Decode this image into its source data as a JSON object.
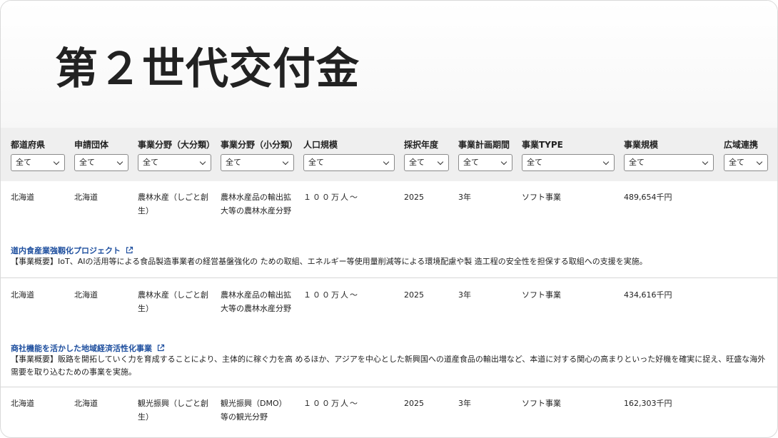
{
  "page": {
    "title": "第２世代交付金"
  },
  "filters": [
    {
      "label": "都道府県",
      "value": "全て"
    },
    {
      "label": "申請団体",
      "value": "全て"
    },
    {
      "label": "事業分野（大分類）",
      "value": "全て"
    },
    {
      "label": "事業分野（小分類）",
      "value": "全て"
    },
    {
      "label": "人口規模",
      "value": "全て"
    },
    {
      "label": "採択年度",
      "value": "全て"
    },
    {
      "label": "事業計画期間",
      "value": "全て"
    },
    {
      "label": "事業TYPE",
      "value": "全て"
    },
    {
      "label": "事業規模",
      "value": "全て"
    },
    {
      "label": "広域連携",
      "value": "全て"
    }
  ],
  "rows": [
    {
      "prefecture": "北海道",
      "applicant": "北海道",
      "field_major": "農林水産（しごと創生）",
      "field_minor": "農林水産品の輸出拡大等の農林水産分野",
      "population": "１００万人〜",
      "year": "2025",
      "period": "3年",
      "type": "ソフト事業",
      "scale": "489,654千円",
      "project_title": "道内食産業強靱化プロジェクト",
      "summary": "【事業概要】IoT、AIの活用等による食品製造事業者の経営基盤強化の ための取組、エネルギー等使用量削減等による環境配慮や製 造工程の安全性を担保する取組への支援を実施。"
    },
    {
      "prefecture": "北海道",
      "applicant": "北海道",
      "field_major": "農林水産（しごと創生）",
      "field_minor": "農林水産品の輸出拡大等の農林水産分野",
      "population": "１００万人〜",
      "year": "2025",
      "period": "3年",
      "type": "ソフト事業",
      "scale": "434,616千円",
      "project_title": "商社機能を活かした地域経済活性化事業",
      "summary": "【事業概要】販路を開拓していく力を育成することにより、主体的に稼ぐ力を高 めるほか、アジアを中心とした新興国への道産食品の輸出増など、本道に対する関心の高まりといった好機を確実に捉え、旺盛な海外需要を取り込むための事業を実施。"
    },
    {
      "prefecture": "北海道",
      "applicant": "北海道",
      "field_major": "観光振興（しごと創生）",
      "field_minor": "観光振興（DMO）等の観光分野",
      "population": "１００万人〜",
      "year": "2025",
      "period": "3年",
      "type": "ソフト事業",
      "scale": "162,303千円"
    }
  ]
}
